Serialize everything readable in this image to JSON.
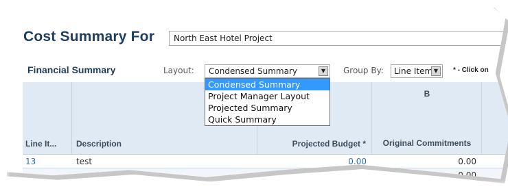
{
  "header": {
    "title": "Cost Summary For",
    "project_value": "North East Hotel Project"
  },
  "toolbar": {
    "section_title": "Financial Summary",
    "layout_label": "Layout:",
    "layout_value": "Condensed Summary",
    "groupby_label": "Group By:",
    "groupby_value": "Line Item",
    "note": "* - Click on"
  },
  "layout_options": [
    "Condensed Summary",
    "Project Manager Layout",
    "Projected Summary",
    "Quick Summary"
  ],
  "table": {
    "columns": [
      {
        "label": "Line It...",
        "letter": ""
      },
      {
        "label": "Description",
        "letter": ""
      },
      {
        "label": "Projected Budget *",
        "letter": ""
      },
      {
        "label": "Original Commitments",
        "letter": "B"
      }
    ],
    "rows": [
      {
        "line_item": "13",
        "description": "test",
        "projected_budget": "0.00",
        "original_commitments": "0.00"
      },
      {
        "line_item": "",
        "description": "",
        "projected_budget": "0.00",
        "original_commitments": "0.00"
      }
    ]
  },
  "colors": {
    "title": "#1f3d5c",
    "header_bg": "#dfeaf5",
    "selection": "#3399ff",
    "link": "#2a6ebb"
  }
}
